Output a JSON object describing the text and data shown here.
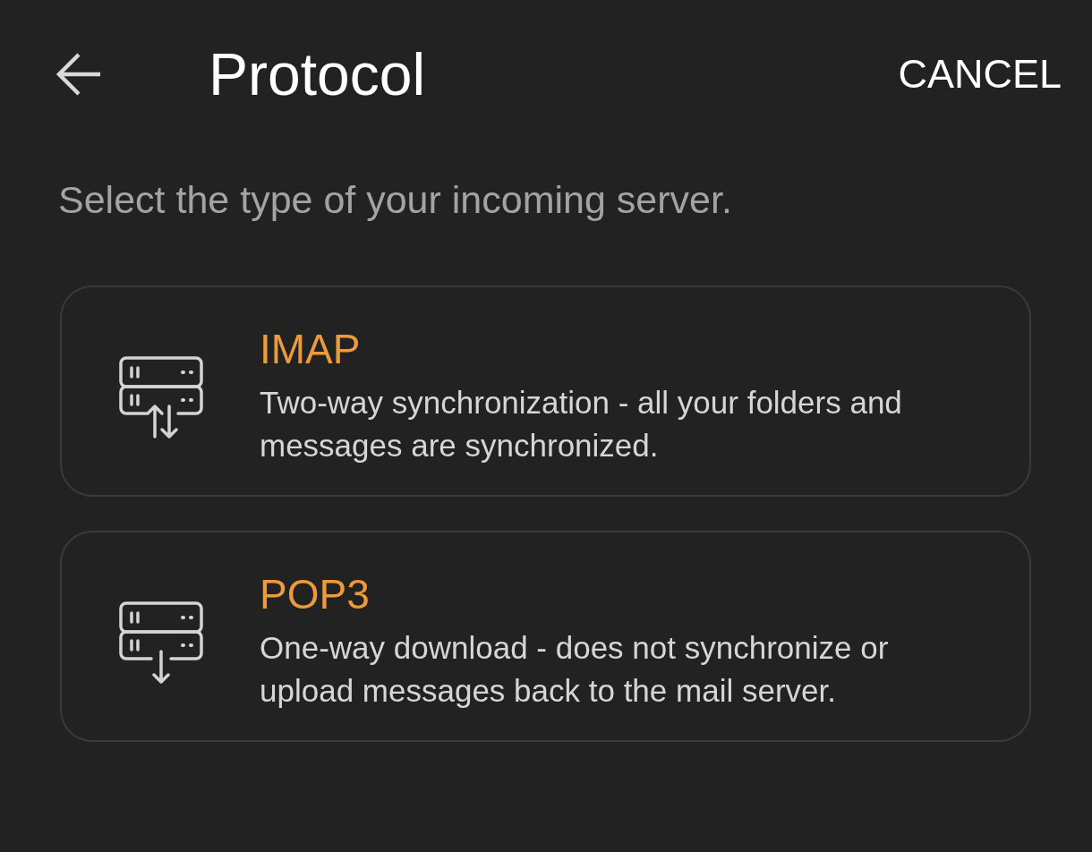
{
  "header": {
    "title": "Protocol",
    "action": "CANCEL"
  },
  "instruction": "Select the type of your incoming server.",
  "options": [
    {
      "kind": "sync",
      "title": "IMAP",
      "description": "Two-way synchronization - all your folders and messages are synchronized."
    },
    {
      "kind": "download",
      "title": "POP3",
      "description": "One-way download - does not synchronize or upload messages back to the mail server."
    }
  ]
}
